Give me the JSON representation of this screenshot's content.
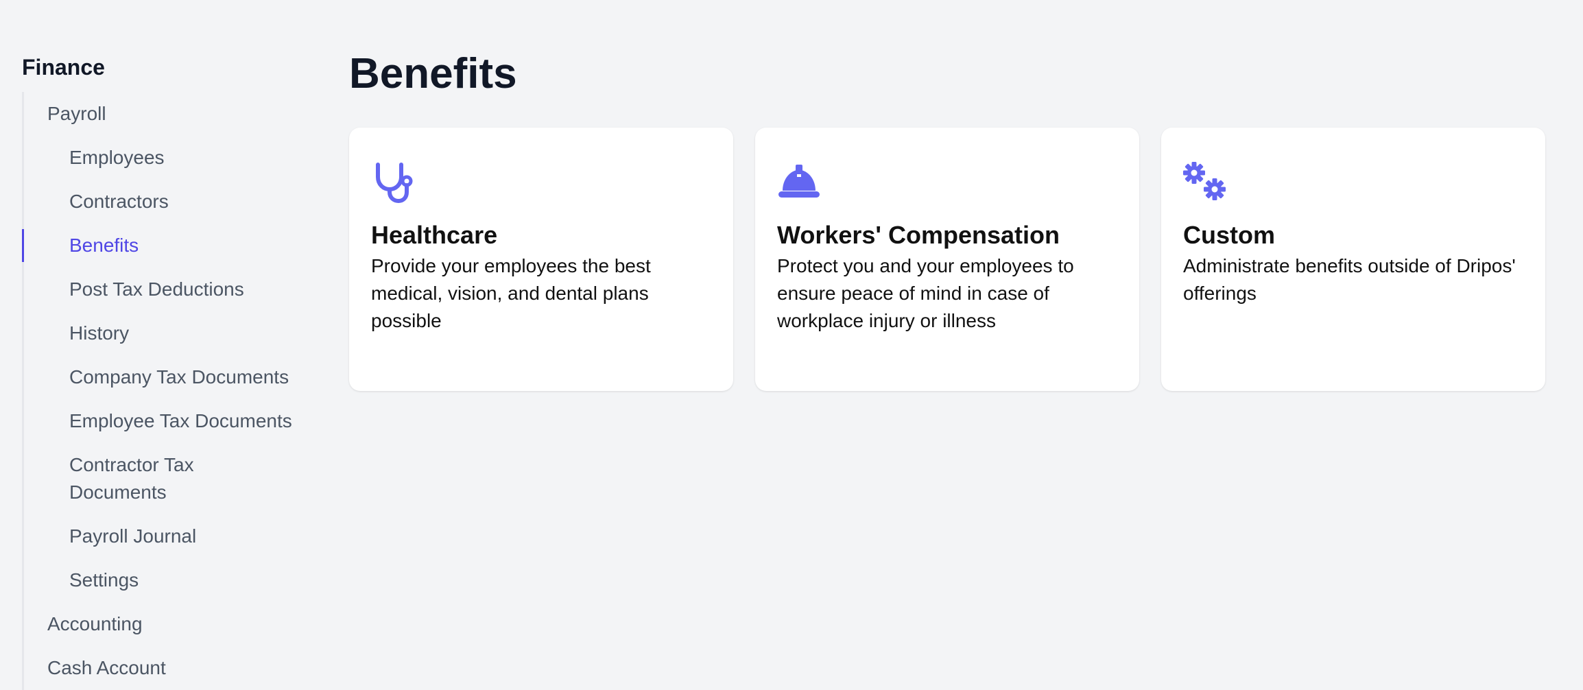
{
  "sidebar": {
    "section_title": "Finance",
    "items": [
      {
        "label": "Payroll"
      },
      {
        "label": "Employees"
      },
      {
        "label": "Contractors"
      },
      {
        "label": "Benefits"
      },
      {
        "label": "Post Tax Deductions"
      },
      {
        "label": "History"
      },
      {
        "label": "Company Tax Documents"
      },
      {
        "label": "Employee Tax Documents"
      },
      {
        "label": "Contractor Tax Documents"
      },
      {
        "label": "Payroll Journal"
      },
      {
        "label": "Settings"
      },
      {
        "label": "Accounting"
      },
      {
        "label": "Cash Account"
      }
    ]
  },
  "main": {
    "title": "Benefits",
    "cards": [
      {
        "icon": "stethoscope-icon",
        "title": "Healthcare",
        "description": "Provide your employees the best medical, vision, and dental plans possible"
      },
      {
        "icon": "hard-hat-icon",
        "title": "Workers' Compensation",
        "description": "Protect you and your employees to ensure peace of mind in case of workplace injury or illness"
      },
      {
        "icon": "gears-icon",
        "title": "Custom",
        "description": "Administrate benefits outside of Dripos' offerings"
      }
    ]
  },
  "colors": {
    "accent": "#6366f1",
    "active_nav": "#4f46e5",
    "background": "#f3f4f6"
  }
}
